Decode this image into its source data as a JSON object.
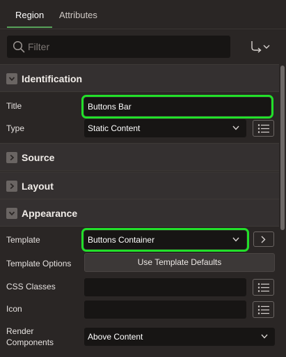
{
  "tabs": [
    {
      "label": "Region",
      "active": true
    },
    {
      "label": "Attributes",
      "active": false
    }
  ],
  "filter": {
    "placeholder": "Filter",
    "value": ""
  },
  "colors": {
    "accent_tab": "#58a35a",
    "highlight": "#22e02a",
    "background": "#2a2625",
    "field": "#171514"
  },
  "icons": {
    "search": "search-icon",
    "goto": "goto-group-icon",
    "expand": "chevron-right-icon",
    "collapse": "chevron-down-icon",
    "list": "list-icon",
    "next": "chevron-right-icon"
  },
  "sections": {
    "identification": {
      "title": "Identification",
      "title_label": "Title",
      "title_value": "Buttons Bar",
      "type_label": "Type",
      "type_value": "Static Content"
    },
    "source": {
      "title": "Source"
    },
    "layout": {
      "title": "Layout"
    },
    "appearance": {
      "title": "Appearance",
      "template_label": "Template",
      "template_value": "Buttons Container",
      "template_options_label": "Template Options",
      "template_options_button": "Use Template Defaults",
      "css_classes_label": "CSS Classes",
      "css_classes_value": "",
      "icon_label": "Icon",
      "icon_value": "",
      "render_components_label_1": "Render",
      "render_components_label_2": "Components",
      "render_components_value": "Above Content"
    }
  }
}
